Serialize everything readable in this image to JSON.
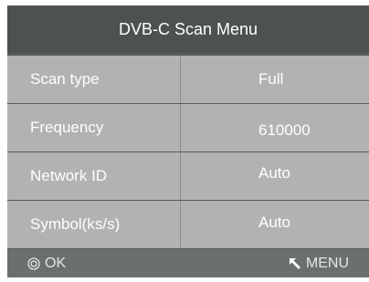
{
  "header": {
    "title": "DVB-C Scan Menu"
  },
  "rows": [
    {
      "label": "Scan type",
      "value": "Full"
    },
    {
      "label": "Frequency",
      "value": "610000"
    },
    {
      "label": "Network ID",
      "value": "Auto"
    },
    {
      "label": "Symbol(ks/s)",
      "value": "Auto"
    }
  ],
  "footer": {
    "ok_label": "OK",
    "ok_icon": "ok-circle-icon",
    "menu_label": "MENU",
    "menu_icon": "return-arrow-icon"
  },
  "colors": {
    "header_bg": "#4d5152",
    "row_bg": "#b2b2b2",
    "footer_bg": "#6b6f70",
    "text": "#ffffff"
  }
}
